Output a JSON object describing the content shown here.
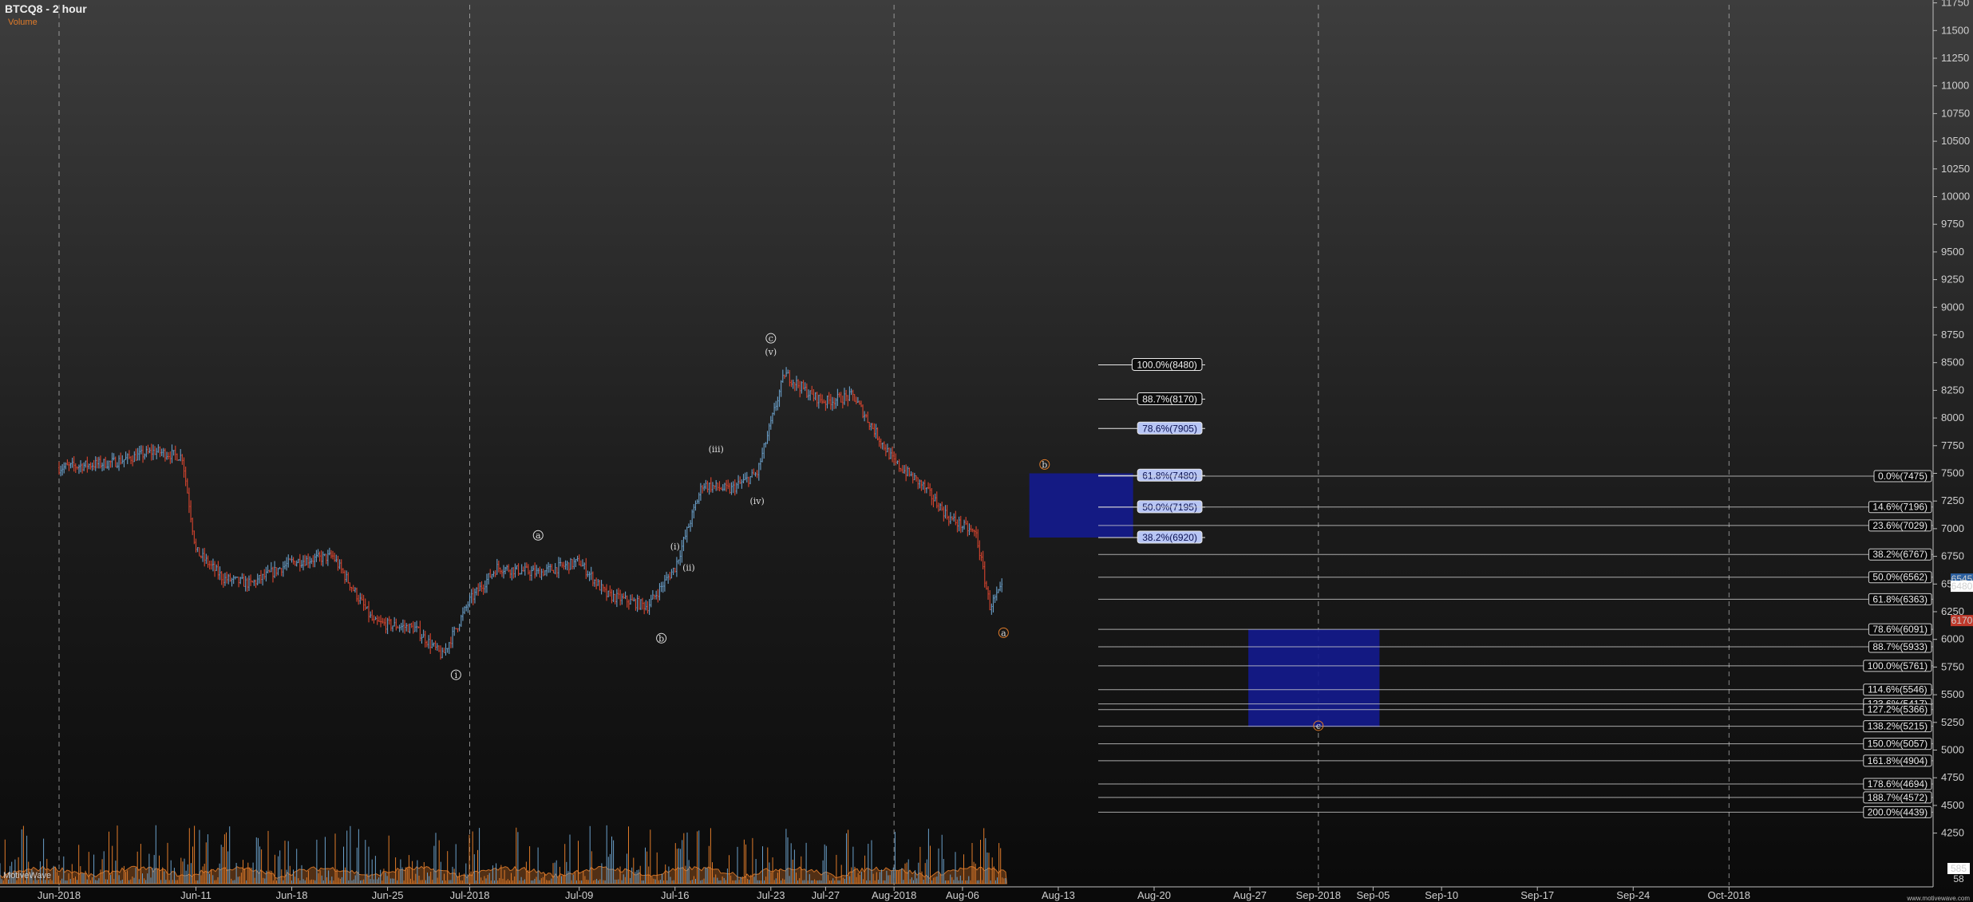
{
  "header": {
    "title": "BTCQ8 - 2 hour",
    "indicator": "Volume"
  },
  "footer": {
    "brand": "MotiveWave",
    "watermark": "www.motivewave.com"
  },
  "chart_data": {
    "type": "candlestick",
    "symbol": "BTCQ8",
    "timeframe": "2 hour",
    "x_ticks": [
      "Jun-2018",
      "Jun-11",
      "Jun-18",
      "Jun-25",
      "Jul-2018",
      "Jul-09",
      "Jul-16",
      "Jul-23",
      "Jul-27",
      "Aug-2018",
      "Aug-06",
      "Aug-13",
      "Aug-20",
      "Aug-27",
      "Sep-2018",
      "Sep-05",
      "Sep-10",
      "Sep-17",
      "Sep-24",
      "Oct-2018"
    ],
    "y_ticks": [
      11750,
      11500,
      11250,
      11000,
      10750,
      10500,
      10250,
      10000,
      9750,
      9500,
      9250,
      9000,
      8750,
      8500,
      8250,
      8000,
      7750,
      7500,
      7250,
      7000,
      6750,
      6500,
      6250,
      6000,
      5750,
      5500,
      5250,
      5000,
      4750,
      4500,
      4250
    ],
    "ylim": [
      4100,
      11900
    ],
    "price_path": [
      {
        "date": "Jun-2018",
        "close": 7550
      },
      {
        "date": "Jun-05",
        "close": 7600
      },
      {
        "date": "Jun-08",
        "close": 7700
      },
      {
        "date": "Jun-10",
        "close": 7650
      },
      {
        "date": "Jun-11",
        "close": 6800
      },
      {
        "date": "Jun-13",
        "close": 6550
      },
      {
        "date": "Jun-15",
        "close": 6500
      },
      {
        "date": "Jun-18",
        "close": 6700
      },
      {
        "date": "Jun-21",
        "close": 6750
      },
      {
        "date": "Jun-24",
        "close": 6150
      },
      {
        "date": "Jun-27",
        "close": 6100
      },
      {
        "date": "Jun-29",
        "close": 5850
      },
      {
        "date": "Jul-2018",
        "close": 6350
      },
      {
        "date": "Jul-03",
        "close": 6650
      },
      {
        "date": "Jul-06",
        "close": 6600
      },
      {
        "date": "Jul-09",
        "close": 6700
      },
      {
        "date": "Jul-11",
        "close": 6400
      },
      {
        "date": "Jul-14",
        "close": 6300
      },
      {
        "date": "Jul-16",
        "close": 6650
      },
      {
        "date": "Jul-18",
        "close": 7400
      },
      {
        "date": "Jul-20",
        "close": 7350
      },
      {
        "date": "Jul-22",
        "close": 7500
      },
      {
        "date": "Jul-24",
        "close": 8400
      },
      {
        "date": "Jul-26",
        "close": 8200
      },
      {
        "date": "Jul-27",
        "close": 8150
      },
      {
        "date": "Jul-29",
        "close": 8200
      },
      {
        "date": "Aug-2018",
        "close": 7600
      },
      {
        "date": "Aug-03",
        "close": 7400
      },
      {
        "date": "Aug-05",
        "close": 7100
      },
      {
        "date": "Aug-07",
        "close": 6950
      },
      {
        "date": "Aug-08",
        "close": 6300
      },
      {
        "date": "Aug-09",
        "close": 6480
      }
    ],
    "last_price": 6480,
    "price_labels": [
      {
        "text": "6545",
        "value": 6545,
        "bg": "#2b5f9e"
      },
      {
        "text": "6480",
        "value": 6480,
        "bg": "#ffffff"
      },
      {
        "text": "6170",
        "value": 6170,
        "bg": "#c0392b"
      }
    ],
    "wave_labels": [
      {
        "text": "c",
        "date": "Jul-23",
        "value": 8720,
        "circled": true,
        "color": "#ddd"
      },
      {
        "text": "(v)",
        "date": "Jul-23",
        "value": 8600,
        "circled": false,
        "color": "#ddd"
      },
      {
        "text": "(iii)",
        "date": "Jul-19",
        "value": 7720,
        "circled": false,
        "color": "#ddd"
      },
      {
        "text": "(iv)",
        "date": "Jul-22",
        "value": 7250,
        "circled": false,
        "color": "#ddd"
      },
      {
        "text": "(ii)",
        "date": "Jul-17",
        "value": 6650,
        "circled": false,
        "color": "#ddd"
      },
      {
        "text": "(i)",
        "date": "Jul-16",
        "value": 6840,
        "circled": false,
        "color": "#ddd"
      },
      {
        "text": "a",
        "date": "Jul-06",
        "value": 6940,
        "circled": true,
        "color": "#ddd"
      },
      {
        "text": "b",
        "date": "Jul-15",
        "value": 6010,
        "circled": true,
        "color": "#ddd"
      },
      {
        "text": "i",
        "date": "Jun-30",
        "value": 5680,
        "circled": true,
        "color": "#ddd"
      },
      {
        "text": "a",
        "date": "Aug-09",
        "value": 6060,
        "circled": true,
        "color": "#e07b2a"
      },
      {
        "text": "b",
        "date": "Aug-12",
        "value": 7580,
        "circled": true,
        "color": "#e07b2a"
      },
      {
        "text": "c",
        "date": "Sep-2018",
        "value": 5220,
        "circled": true,
        "color": "#e07b2a"
      }
    ],
    "retracement_fibs": [
      {
        "label": "100.0%(8480)",
        "value": 8480,
        "highlight": false
      },
      {
        "label": "88.7%(8170)",
        "value": 8170,
        "highlight": false
      },
      {
        "label": "78.6%(7905)",
        "value": 7905,
        "highlight": true
      },
      {
        "label": "61.8%(7480)",
        "value": 7480,
        "highlight": true
      },
      {
        "label": "50.0%(7195)",
        "value": 7195,
        "highlight": true
      },
      {
        "label": "38.2%(6920)",
        "value": 6920,
        "highlight": true
      }
    ],
    "extension_fibs": [
      {
        "label": "0.0%(7475)",
        "value": 7475
      },
      {
        "label": "14.6%(7196)",
        "value": 7196
      },
      {
        "label": "23.6%(7029)",
        "value": 7029
      },
      {
        "label": "38.2%(6767)",
        "value": 6767
      },
      {
        "label": "50.0%(6562)",
        "value": 6562
      },
      {
        "label": "61.8%(6363)",
        "value": 6363
      },
      {
        "label": "78.6%(6091)",
        "value": 6091
      },
      {
        "label": "88.7%(5933)",
        "value": 5933
      },
      {
        "label": "100.0%(5761)",
        "value": 5761
      },
      {
        "label": "114.6%(5546)",
        "value": 5546
      },
      {
        "label": "123.6%(5417)",
        "value": 5417
      },
      {
        "label": "127.2%(5366)",
        "value": 5366
      },
      {
        "label": "138.2%(5215)",
        "value": 5215
      },
      {
        "label": "150.0%(5057)",
        "value": 5057
      },
      {
        "label": "161.8%(4904)",
        "value": 4904
      },
      {
        "label": "178.6%(4694)",
        "value": 4694
      },
      {
        "label": "188.7%(4572)",
        "value": 4572
      },
      {
        "label": "200.0%(4439)",
        "value": 4439
      }
    ],
    "zones": [
      {
        "name": "b-target",
        "price_top": 7500,
        "price_bottom": 6920,
        "date_from": "Aug-11",
        "date_to": "Aug-18",
        "color": "#141a8c"
      },
      {
        "name": "c-target",
        "price_top": 6090,
        "price_bottom": 5210,
        "date_from": "Aug-27",
        "date_to": "Sep-05",
        "color": "#141a8c"
      }
    ],
    "volume_axis_labels": [
      "585",
      "58"
    ],
    "colors": {
      "up": "#6a9fc9",
      "down": "#d9452f",
      "volume": "#e07b2a",
      "grid": "#bdbdbd"
    }
  }
}
